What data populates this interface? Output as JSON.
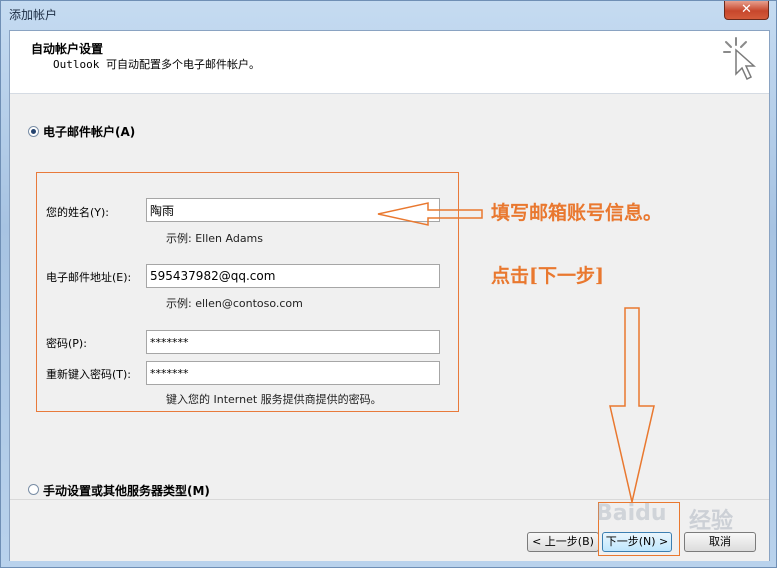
{
  "window": {
    "title": "添加帐户",
    "close_glyph": "✕"
  },
  "header": {
    "title": "自动帐户设置",
    "subtitle": "Outlook 可自动配置多个电子邮件帐户。"
  },
  "options": {
    "email_account": {
      "label": "电子邮件帐户(A)",
      "checked": true
    },
    "manual": {
      "label": "手动设置或其他服务器类型(M)",
      "checked": false
    }
  },
  "form": {
    "name": {
      "label": "您的姓名(Y):",
      "value": "陶雨",
      "hint": "示例: Ellen Adams"
    },
    "email": {
      "label": "电子邮件地址(E):",
      "value": "595437982@qq.com",
      "hint": "示例: ellen@contoso.com"
    },
    "password": {
      "label": "密码(P):",
      "value": "*******"
    },
    "retype": {
      "label": "重新键入密码(T):",
      "value": "*******"
    },
    "password_hint": "键入您的 Internet 服务提供商提供的密码。"
  },
  "buttons": {
    "back": "< 上一步(B)",
    "next": "下一步(N) >",
    "cancel": "取消"
  },
  "annotations": {
    "fill_info": "填写邮箱账号信息。",
    "click_next": "点击[下一步]",
    "color": "#e9782f"
  },
  "watermark": {
    "text_latin": "Baidu",
    "text_cn": "经验"
  }
}
